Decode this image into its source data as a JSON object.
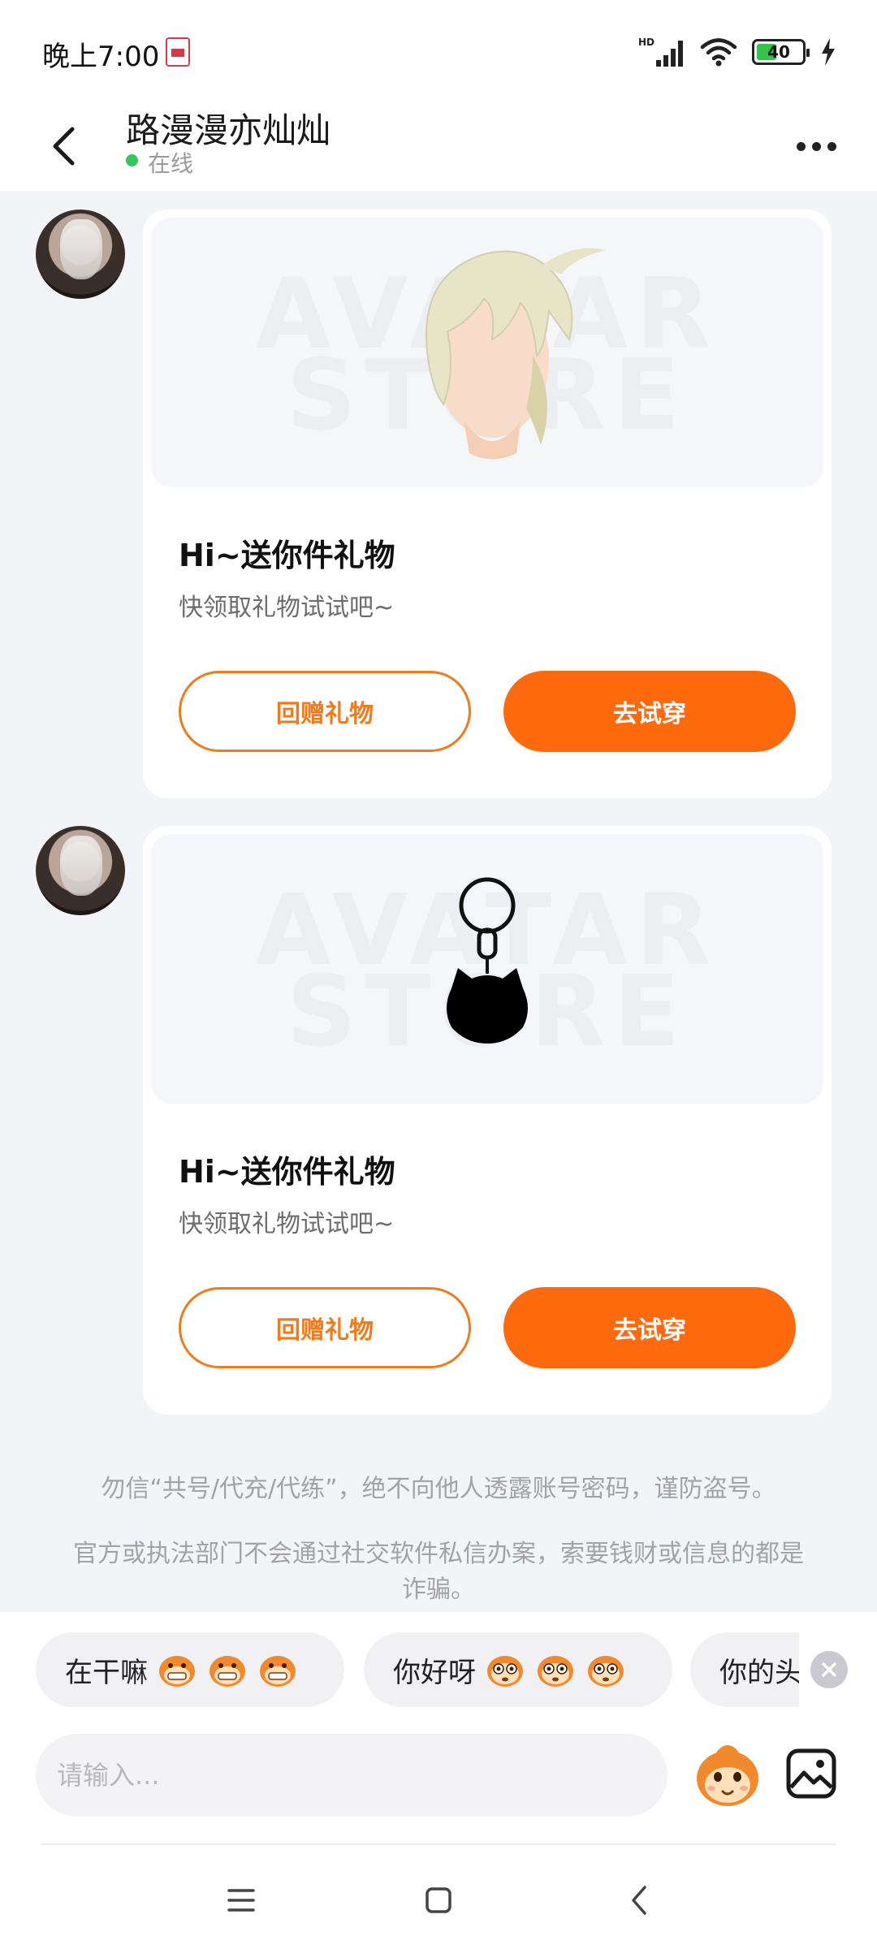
{
  "status_bar": {
    "time": "晚上7:00",
    "battery_level": "40",
    "icons": [
      "hd-signal-icon",
      "wifi-icon",
      "battery-icon",
      "charging-icon"
    ]
  },
  "header": {
    "title": "路漫漫亦灿灿",
    "status": "在线"
  },
  "messages": [
    {
      "gift": "wig-hair-gift",
      "watermark": "AVATAR STORE",
      "title": "Hi~送你件礼物",
      "subtitle": "快领取礼物试试吧~",
      "return_gift_label": "回赠礼物",
      "try_on_label": "去试穿"
    },
    {
      "gift": "cat-keychain-gift",
      "watermark": "AVATAR STORE",
      "title": "Hi~送你件礼物",
      "subtitle": "快领取礼物试试吧~",
      "return_gift_label": "回赠礼物",
      "try_on_label": "去试穿"
    }
  ],
  "notice": {
    "line1": "勿信“共号/代充/代练”，绝不向他人透露账号密码，谨防盗号。",
    "line2": "官方或执法部门不会通过社交软件私信办案，索要钱财或信息的都是诈骗。"
  },
  "quick_replies": [
    {
      "text": "在干嘛",
      "emoji": "grinning-monkey-emoji"
    },
    {
      "text": "你好呀",
      "emoji": "big-eye-monkey-emoji"
    },
    {
      "text": "你的头",
      "emoji": ""
    }
  ],
  "composer": {
    "placeholder": "请输入..."
  },
  "colors": {
    "accent": "#ff6a0f",
    "accent_outline": "#f07b1d",
    "online": "#34c759",
    "background": "#f3f4f8"
  }
}
